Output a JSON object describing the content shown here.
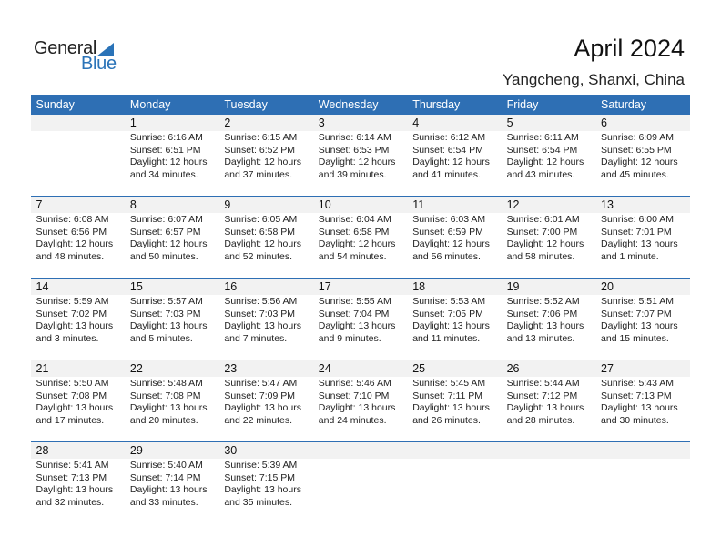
{
  "logo": {
    "general": "General",
    "blue": "Blue"
  },
  "header": {
    "title": "April 2024",
    "location": "Yangcheng, Shanxi, China"
  },
  "colors": {
    "accent": "#2e6fb4",
    "day_number_bg": "#f2f2f2"
  },
  "weekdays": [
    "Sunday",
    "Monday",
    "Tuesday",
    "Wednesday",
    "Thursday",
    "Friday",
    "Saturday"
  ],
  "weeks": [
    [
      null,
      {
        "day": "1",
        "sunrise": "Sunrise: 6:16 AM",
        "sunset": "Sunset: 6:51 PM",
        "daylight1": "Daylight: 12 hours",
        "daylight2": "and 34 minutes."
      },
      {
        "day": "2",
        "sunrise": "Sunrise: 6:15 AM",
        "sunset": "Sunset: 6:52 PM",
        "daylight1": "Daylight: 12 hours",
        "daylight2": "and 37 minutes."
      },
      {
        "day": "3",
        "sunrise": "Sunrise: 6:14 AM",
        "sunset": "Sunset: 6:53 PM",
        "daylight1": "Daylight: 12 hours",
        "daylight2": "and 39 minutes."
      },
      {
        "day": "4",
        "sunrise": "Sunrise: 6:12 AM",
        "sunset": "Sunset: 6:54 PM",
        "daylight1": "Daylight: 12 hours",
        "daylight2": "and 41 minutes."
      },
      {
        "day": "5",
        "sunrise": "Sunrise: 6:11 AM",
        "sunset": "Sunset: 6:54 PM",
        "daylight1": "Daylight: 12 hours",
        "daylight2": "and 43 minutes."
      },
      {
        "day": "6",
        "sunrise": "Sunrise: 6:09 AM",
        "sunset": "Sunset: 6:55 PM",
        "daylight1": "Daylight: 12 hours",
        "daylight2": "and 45 minutes."
      }
    ],
    [
      {
        "day": "7",
        "sunrise": "Sunrise: 6:08 AM",
        "sunset": "Sunset: 6:56 PM",
        "daylight1": "Daylight: 12 hours",
        "daylight2": "and 48 minutes."
      },
      {
        "day": "8",
        "sunrise": "Sunrise: 6:07 AM",
        "sunset": "Sunset: 6:57 PM",
        "daylight1": "Daylight: 12 hours",
        "daylight2": "and 50 minutes."
      },
      {
        "day": "9",
        "sunrise": "Sunrise: 6:05 AM",
        "sunset": "Sunset: 6:58 PM",
        "daylight1": "Daylight: 12 hours",
        "daylight2": "and 52 minutes."
      },
      {
        "day": "10",
        "sunrise": "Sunrise: 6:04 AM",
        "sunset": "Sunset: 6:58 PM",
        "daylight1": "Daylight: 12 hours",
        "daylight2": "and 54 minutes."
      },
      {
        "day": "11",
        "sunrise": "Sunrise: 6:03 AM",
        "sunset": "Sunset: 6:59 PM",
        "daylight1": "Daylight: 12 hours",
        "daylight2": "and 56 minutes."
      },
      {
        "day": "12",
        "sunrise": "Sunrise: 6:01 AM",
        "sunset": "Sunset: 7:00 PM",
        "daylight1": "Daylight: 12 hours",
        "daylight2": "and 58 minutes."
      },
      {
        "day": "13",
        "sunrise": "Sunrise: 6:00 AM",
        "sunset": "Sunset: 7:01 PM",
        "daylight1": "Daylight: 13 hours",
        "daylight2": "and 1 minute."
      }
    ],
    [
      {
        "day": "14",
        "sunrise": "Sunrise: 5:59 AM",
        "sunset": "Sunset: 7:02 PM",
        "daylight1": "Daylight: 13 hours",
        "daylight2": "and 3 minutes."
      },
      {
        "day": "15",
        "sunrise": "Sunrise: 5:57 AM",
        "sunset": "Sunset: 7:03 PM",
        "daylight1": "Daylight: 13 hours",
        "daylight2": "and 5 minutes."
      },
      {
        "day": "16",
        "sunrise": "Sunrise: 5:56 AM",
        "sunset": "Sunset: 7:03 PM",
        "daylight1": "Daylight: 13 hours",
        "daylight2": "and 7 minutes."
      },
      {
        "day": "17",
        "sunrise": "Sunrise: 5:55 AM",
        "sunset": "Sunset: 7:04 PM",
        "daylight1": "Daylight: 13 hours",
        "daylight2": "and 9 minutes."
      },
      {
        "day": "18",
        "sunrise": "Sunrise: 5:53 AM",
        "sunset": "Sunset: 7:05 PM",
        "daylight1": "Daylight: 13 hours",
        "daylight2": "and 11 minutes."
      },
      {
        "day": "19",
        "sunrise": "Sunrise: 5:52 AM",
        "sunset": "Sunset: 7:06 PM",
        "daylight1": "Daylight: 13 hours",
        "daylight2": "and 13 minutes."
      },
      {
        "day": "20",
        "sunrise": "Sunrise: 5:51 AM",
        "sunset": "Sunset: 7:07 PM",
        "daylight1": "Daylight: 13 hours",
        "daylight2": "and 15 minutes."
      }
    ],
    [
      {
        "day": "21",
        "sunrise": "Sunrise: 5:50 AM",
        "sunset": "Sunset: 7:08 PM",
        "daylight1": "Daylight: 13 hours",
        "daylight2": "and 17 minutes."
      },
      {
        "day": "22",
        "sunrise": "Sunrise: 5:48 AM",
        "sunset": "Sunset: 7:08 PM",
        "daylight1": "Daylight: 13 hours",
        "daylight2": "and 20 minutes."
      },
      {
        "day": "23",
        "sunrise": "Sunrise: 5:47 AM",
        "sunset": "Sunset: 7:09 PM",
        "daylight1": "Daylight: 13 hours",
        "daylight2": "and 22 minutes."
      },
      {
        "day": "24",
        "sunrise": "Sunrise: 5:46 AM",
        "sunset": "Sunset: 7:10 PM",
        "daylight1": "Daylight: 13 hours",
        "daylight2": "and 24 minutes."
      },
      {
        "day": "25",
        "sunrise": "Sunrise: 5:45 AM",
        "sunset": "Sunset: 7:11 PM",
        "daylight1": "Daylight: 13 hours",
        "daylight2": "and 26 minutes."
      },
      {
        "day": "26",
        "sunrise": "Sunrise: 5:44 AM",
        "sunset": "Sunset: 7:12 PM",
        "daylight1": "Daylight: 13 hours",
        "daylight2": "and 28 minutes."
      },
      {
        "day": "27",
        "sunrise": "Sunrise: 5:43 AM",
        "sunset": "Sunset: 7:13 PM",
        "daylight1": "Daylight: 13 hours",
        "daylight2": "and 30 minutes."
      }
    ],
    [
      {
        "day": "28",
        "sunrise": "Sunrise: 5:41 AM",
        "sunset": "Sunset: 7:13 PM",
        "daylight1": "Daylight: 13 hours",
        "daylight2": "and 32 minutes."
      },
      {
        "day": "29",
        "sunrise": "Sunrise: 5:40 AM",
        "sunset": "Sunset: 7:14 PM",
        "daylight1": "Daylight: 13 hours",
        "daylight2": "and 33 minutes."
      },
      {
        "day": "30",
        "sunrise": "Sunrise: 5:39 AM",
        "sunset": "Sunset: 7:15 PM",
        "daylight1": "Daylight: 13 hours",
        "daylight2": "and 35 minutes."
      },
      null,
      null,
      null,
      null
    ]
  ]
}
